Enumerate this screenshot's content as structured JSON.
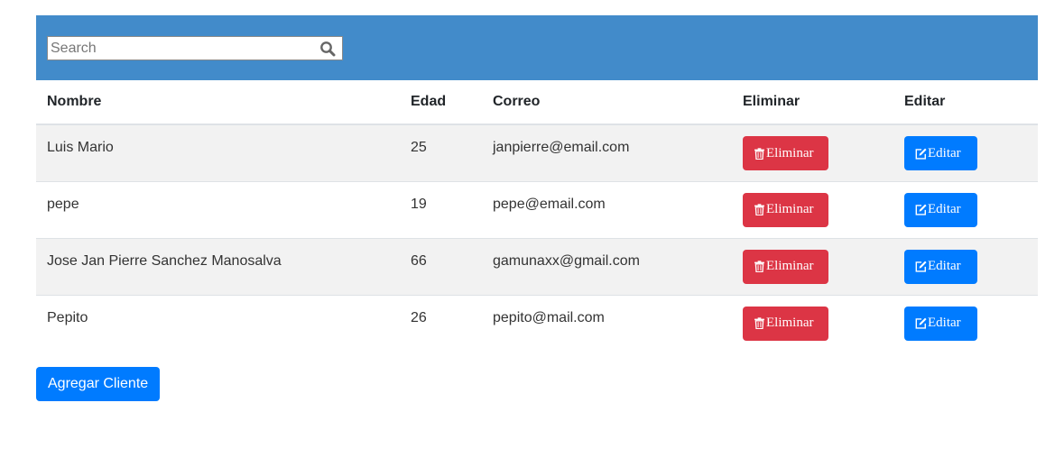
{
  "search": {
    "placeholder": "Search",
    "value": ""
  },
  "table": {
    "headers": {
      "nombre": "Nombre",
      "edad": "Edad",
      "correo": "Correo",
      "eliminar": "Eliminar",
      "editar": "Editar"
    },
    "rows": [
      {
        "nombre": "Luis Mario",
        "edad": "25",
        "correo": "janpierre@email.com",
        "delete_label": "Eliminar",
        "edit_label": "Editar"
      },
      {
        "nombre": "pepe",
        "edad": "19",
        "correo": "pepe@email.com",
        "delete_label": "Eliminar",
        "edit_label": "Editar"
      },
      {
        "nombre": "Jose Jan Pierre Sanchez Manosalva",
        "edad": "66",
        "correo": "gamunaxx@gmail.com",
        "delete_label": "Eliminar",
        "edit_label": "Editar"
      },
      {
        "nombre": "Pepito",
        "edad": "26",
        "correo": "pepito@mail.com",
        "delete_label": "Eliminar",
        "edit_label": "Editar"
      }
    ]
  },
  "add_button_label": "Agregar Cliente",
  "colors": {
    "header_bar": "#428bca",
    "danger": "#dc3545",
    "primary": "#007bff",
    "striped_row": "#f2f2f2"
  },
  "icons": {
    "search": "search-icon",
    "delete": "trash-icon",
    "edit": "edit-icon"
  }
}
